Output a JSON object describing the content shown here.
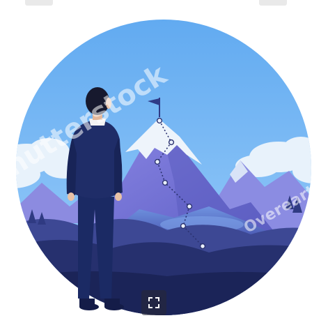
{
  "image": {
    "watermark_brand": "shutterstock",
    "watermark_credit": "Overearth"
  },
  "colors": {
    "sky": "#6fb8f5",
    "sky_deep": "#4f9de8",
    "cloud": "#e6f1fb",
    "snow": "#eef4fb",
    "mountain_main": "#7578d8",
    "mountain_shadow": "#5557b8",
    "mountain_back": "#8f8ee0",
    "hills_front": "#25306c",
    "hills_mid": "#3b4592",
    "suit": "#1d2a63",
    "suit_shadow": "#141c48",
    "hair": "#16182c",
    "skin": "#e9c2a6",
    "path_dots": "#2b3270",
    "flag": "#2f3a86"
  },
  "icons": {
    "expand": "expand-icon",
    "flag": "flag-icon"
  }
}
